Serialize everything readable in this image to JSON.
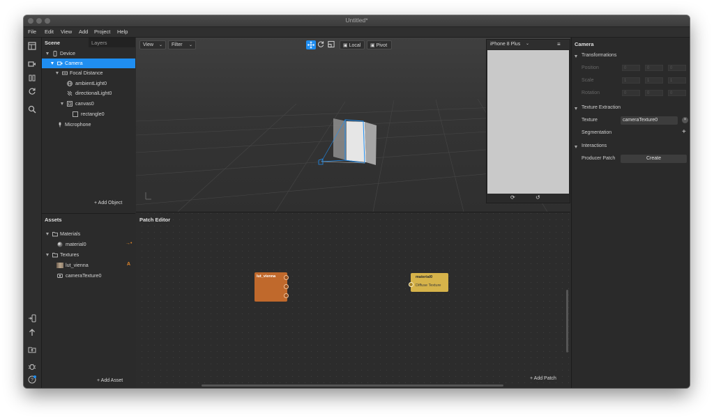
{
  "window": {
    "title": "Untitled*"
  },
  "menu": [
    "File",
    "Edit",
    "View",
    "Add",
    "Project",
    "Help"
  ],
  "scene_panel": {
    "tabs": [
      "Scene",
      "Layers"
    ],
    "tree": [
      {
        "label": "Device",
        "icon": "phone-icon"
      },
      {
        "label": "Camera",
        "icon": "camera-icon",
        "selected": true
      },
      {
        "label": "Focal Distance",
        "icon": "focal-distance-icon"
      },
      {
        "label": "ambientLight0",
        "icon": "globe-light-icon"
      },
      {
        "label": "directionalLight0",
        "icon": "directional-light-icon"
      },
      {
        "label": "canvas0",
        "icon": "canvas-icon"
      },
      {
        "label": "rectangle0",
        "icon": "rectangle-icon"
      },
      {
        "label": "Microphone",
        "icon": "microphone-icon"
      }
    ],
    "add_object": "+ Add Object"
  },
  "assets_panel": {
    "title": "Assets",
    "tree": [
      {
        "label": "Materials",
        "icon": "folder-icon"
      },
      {
        "label": "material0",
        "icon": "material-sphere-icon",
        "badge": "→•"
      },
      {
        "label": "Textures",
        "icon": "folder-icon"
      },
      {
        "label": "lut_vienna",
        "icon": "texture-thumbnail-icon",
        "badge": "A"
      },
      {
        "label": "cameraTexture0",
        "icon": "camera-texture-icon"
      }
    ],
    "add_asset": "+ Add Asset"
  },
  "viewport": {
    "view_label": "View",
    "filter_label": "Filter",
    "local_label": "Local",
    "pivot_label": "Pivot"
  },
  "simulator": {
    "device": "iPhone 8 Plus"
  },
  "patch_editor": {
    "title": "Patch Editor",
    "add_patch": "+ Add Patch",
    "nodes": [
      {
        "title": "lut_vienna",
        "color": "#c0692c"
      },
      {
        "title": "material0",
        "port": "Diffuse Texture",
        "color": "#d6b34a"
      }
    ]
  },
  "inspector": {
    "title": "Camera",
    "transformations": {
      "header": "Transformations",
      "rows": [
        {
          "label": "Position",
          "values": [
            "0",
            "0",
            "0"
          ]
        },
        {
          "label": "Scale",
          "values": [
            "1",
            "1",
            "1"
          ]
        },
        {
          "label": "Rotation",
          "values": [
            "0",
            "0",
            "0"
          ]
        }
      ]
    },
    "texture_extraction": {
      "header": "Texture Extraction",
      "texture_label": "Texture",
      "texture_value": "cameraTexture0",
      "segmentation_label": "Segmentation"
    },
    "interactions": {
      "header": "Interactions",
      "producer_patch_label": "Producer Patch",
      "create_label": "Create"
    }
  },
  "colors": {
    "accent": "#1f8ef1",
    "node_orange": "#c0692c",
    "node_yellow": "#d6b34a"
  }
}
